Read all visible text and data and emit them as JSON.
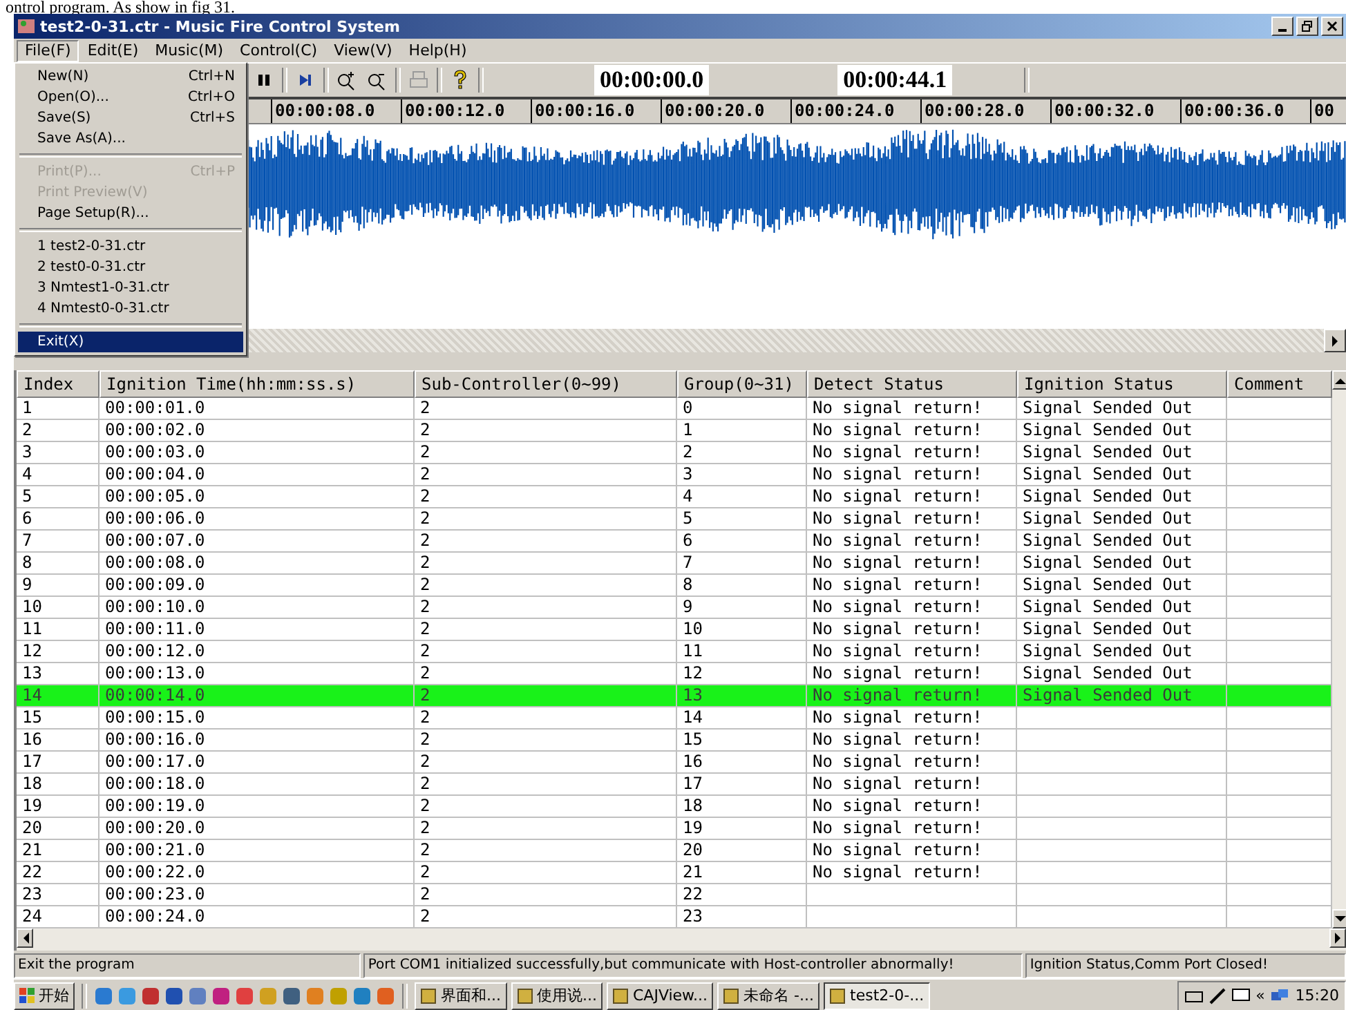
{
  "caption": "ontrol program. As show in fig 31.",
  "window": {
    "title": "test2-0-31.ctr - Music Fire Control System"
  },
  "menubar": [
    {
      "label": "File(F)",
      "selected": true
    },
    {
      "label": "Edit(E)",
      "selected": false
    },
    {
      "label": "Music(M)",
      "selected": false
    },
    {
      "label": "Control(C)",
      "selected": false
    },
    {
      "label": "View(V)",
      "selected": false
    },
    {
      "label": "Help(H)",
      "selected": false
    }
  ],
  "file_menu": [
    {
      "kind": "item",
      "label": "New(N)",
      "shortcut": "Ctrl+N",
      "disabled": false,
      "selected": false
    },
    {
      "kind": "item",
      "label": "Open(O)...",
      "shortcut": "Ctrl+O",
      "disabled": false,
      "selected": false
    },
    {
      "kind": "item",
      "label": "Save(S)",
      "shortcut": "Ctrl+S",
      "disabled": false,
      "selected": false
    },
    {
      "kind": "item",
      "label": "Save As(A)...",
      "disabled": false,
      "selected": false
    },
    {
      "kind": "separator"
    },
    {
      "kind": "item",
      "label": "Print(P)...",
      "shortcut": "Ctrl+P",
      "disabled": true,
      "selected": false
    },
    {
      "kind": "item",
      "label": "Print Preview(V)",
      "disabled": true,
      "selected": false
    },
    {
      "kind": "item",
      "label": "Page Setup(R)...",
      "disabled": false,
      "selected": false
    },
    {
      "kind": "separator"
    },
    {
      "kind": "item",
      "label": "1 test2-0-31.ctr",
      "disabled": false,
      "selected": false
    },
    {
      "kind": "item",
      "label": "2 test0-0-31.ctr",
      "disabled": false,
      "selected": false
    },
    {
      "kind": "item",
      "label": "3 Nmtest1-0-31.ctr",
      "disabled": false,
      "selected": false
    },
    {
      "kind": "item",
      "label": "4 Nmtest0-0-31.ctr",
      "disabled": false,
      "selected": false
    },
    {
      "kind": "separator"
    },
    {
      "kind": "item",
      "label": "Exit(X)",
      "disabled": false,
      "selected": true
    }
  ],
  "toolbar": [
    {
      "kind": "pause",
      "disabled": false
    },
    {
      "kind": "separator"
    },
    {
      "kind": "step",
      "disabled": false
    },
    {
      "kind": "separator"
    },
    {
      "kind": "zoom-in",
      "disabled": false
    },
    {
      "kind": "zoom-out",
      "disabled": false
    },
    {
      "kind": "separator"
    },
    {
      "kind": "print",
      "disabled": true
    },
    {
      "kind": "separator"
    },
    {
      "kind": "help",
      "disabled": false
    },
    {
      "kind": "separator"
    }
  ],
  "time_current": "00:00:00.0",
  "time_total": "00:00:44.1",
  "ruler": [
    "00:00:08.0",
    "00:00:12.0",
    "00:00:16.0",
    "00:00:20.0",
    "00:00:24.0",
    "00:00:28.0",
    "00:00:32.0",
    "00:00:36.0",
    "00"
  ],
  "table": {
    "columns": [
      "Index",
      "Ignition Time(hh:mm:ss.s)",
      "Sub-Controller(0~99)",
      "Group(0~31)",
      "Detect Status",
      "Ignition Status",
      "Comment"
    ],
    "rows": [
      {
        "index": "1",
        "time": "00:00:01.0",
        "sub": "2",
        "group": "0",
        "detect": "No signal return!",
        "ignition": "Signal Sended Out",
        "selected": false
      },
      {
        "index": "2",
        "time": "00:00:02.0",
        "sub": "2",
        "group": "1",
        "detect": "No signal return!",
        "ignition": "Signal Sended Out",
        "selected": false
      },
      {
        "index": "3",
        "time": "00:00:03.0",
        "sub": "2",
        "group": "2",
        "detect": "No signal return!",
        "ignition": "Signal Sended Out",
        "selected": false
      },
      {
        "index": "4",
        "time": "00:00:04.0",
        "sub": "2",
        "group": "3",
        "detect": "No signal return!",
        "ignition": "Signal Sended Out",
        "selected": false
      },
      {
        "index": "5",
        "time": "00:00:05.0",
        "sub": "2",
        "group": "4",
        "detect": "No signal return!",
        "ignition": "Signal Sended Out",
        "selected": false
      },
      {
        "index": "6",
        "time": "00:00:06.0",
        "sub": "2",
        "group": "5",
        "detect": "No signal return!",
        "ignition": "Signal Sended Out",
        "selected": false
      },
      {
        "index": "7",
        "time": "00:00:07.0",
        "sub": "2",
        "group": "6",
        "detect": "No signal return!",
        "ignition": "Signal Sended Out",
        "selected": false
      },
      {
        "index": "8",
        "time": "00:00:08.0",
        "sub": "2",
        "group": "7",
        "detect": "No signal return!",
        "ignition": "Signal Sended Out",
        "selected": false
      },
      {
        "index": "9",
        "time": "00:00:09.0",
        "sub": "2",
        "group": "8",
        "detect": "No signal return!",
        "ignition": "Signal Sended Out",
        "selected": false
      },
      {
        "index": "10",
        "time": "00:00:10.0",
        "sub": "2",
        "group": "9",
        "detect": "No signal return!",
        "ignition": "Signal Sended Out",
        "selected": false
      },
      {
        "index": "11",
        "time": "00:00:11.0",
        "sub": "2",
        "group": "10",
        "detect": "No signal return!",
        "ignition": "Signal Sended Out",
        "selected": false
      },
      {
        "index": "12",
        "time": "00:00:12.0",
        "sub": "2",
        "group": "11",
        "detect": "No signal return!",
        "ignition": "Signal Sended Out",
        "selected": false
      },
      {
        "index": "13",
        "time": "00:00:13.0",
        "sub": "2",
        "group": "12",
        "detect": "No signal return!",
        "ignition": "Signal Sended Out",
        "selected": false
      },
      {
        "index": "14",
        "time": "00:00:14.0",
        "sub": "2",
        "group": "13",
        "detect": "No signal return!",
        "ignition": "Signal Sended Out",
        "selected": true
      },
      {
        "index": "15",
        "time": "00:00:15.0",
        "sub": "2",
        "group": "14",
        "detect": "No signal return!",
        "selected": false
      },
      {
        "index": "16",
        "time": "00:00:16.0",
        "sub": "2",
        "group": "15",
        "detect": "No signal return!",
        "selected": false
      },
      {
        "index": "17",
        "time": "00:00:17.0",
        "sub": "2",
        "group": "16",
        "detect": "No signal return!",
        "selected": false
      },
      {
        "index": "18",
        "time": "00:00:18.0",
        "sub": "2",
        "group": "17",
        "detect": "No signal return!",
        "selected": false
      },
      {
        "index": "19",
        "time": "00:00:19.0",
        "sub": "2",
        "group": "18",
        "detect": "No signal return!",
        "selected": false
      },
      {
        "index": "20",
        "time": "00:00:20.0",
        "sub": "2",
        "group": "19",
        "detect": "No signal return!",
        "selected": false
      },
      {
        "index": "21",
        "time": "00:00:21.0",
        "sub": "2",
        "group": "20",
        "detect": "No signal return!",
        "selected": false
      },
      {
        "index": "22",
        "time": "00:00:22.0",
        "sub": "2",
        "group": "21",
        "detect": "No signal return!",
        "selected": false
      },
      {
        "index": "23",
        "time": "00:00:23.0",
        "sub": "2",
        "group": "22",
        "selected": false
      },
      {
        "index": "24",
        "time": "00:00:24.0",
        "sub": "2",
        "group": "23",
        "selected": false
      }
    ]
  },
  "status_bar": [
    "Exit the program",
    "Port COM1 initialized successfully,but communicate with Host-controller abnormally!",
    "Ignition Status,Comm Port Closed!"
  ],
  "taskbar": {
    "start": "开始",
    "tasks": [
      {
        "label": "界面和...",
        "selected": false
      },
      {
        "label": "使用说...",
        "selected": false
      },
      {
        "label": "CAJView...",
        "selected": false
      },
      {
        "label": "未命名 -...",
        "selected": false
      },
      {
        "label": "test2-0-...",
        "selected": true
      }
    ],
    "tray_toggle": "«",
    "clock": "15:20"
  }
}
